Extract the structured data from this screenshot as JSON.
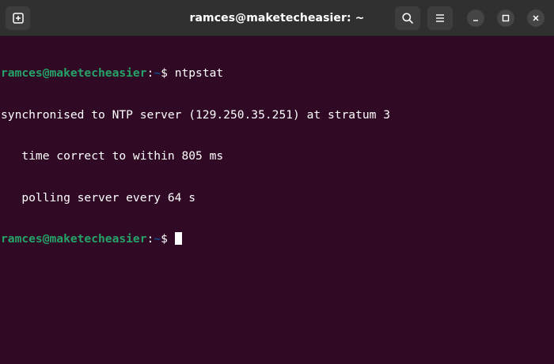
{
  "window": {
    "title": "ramces@maketecheasier: ~"
  },
  "header": {
    "new_tab_icon": "new-tab-icon",
    "search_icon": "search-icon",
    "menu_icon": "hamburger-menu-icon",
    "minimize_icon": "minimize-icon",
    "maximize_icon": "maximize-icon",
    "close_icon": "close-icon"
  },
  "terminal": {
    "prompt_user": "ramces@maketecheasier",
    "prompt_sep": ":",
    "prompt_path": "~",
    "prompt_symbol": "$ ",
    "command": "ntpstat",
    "output": [
      "synchronised to NTP server (129.250.35.251) at stratum 3",
      "   time correct to within 805 ms",
      "   polling server every 64 s"
    ]
  },
  "colors": {
    "background": "#300a24",
    "titlebar": "#303030",
    "prompt_user": "#26a269",
    "prompt_path": "#12488b",
    "text": "#ffffff"
  }
}
